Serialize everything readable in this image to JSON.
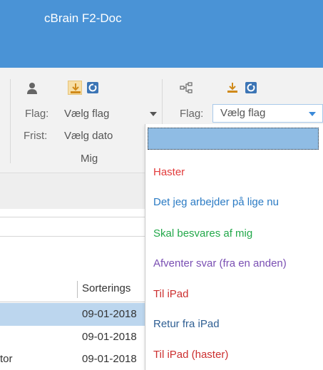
{
  "app": {
    "title": "cBrain F2-Doc"
  },
  "ribbon": {
    "left_group": {
      "flag_label": "Flag:",
      "flag_value": "Vælg flag",
      "deadline_label": "Frist:",
      "deadline_value": "Vælg dato",
      "group_caption": "Mig",
      "icons": [
        "person-icon",
        "download-icon",
        "refresh-icon"
      ]
    },
    "right_group": {
      "flag_label": "Flag:",
      "flag_value": "Vælg flag",
      "icons": [
        "share-nodes-icon",
        "download-icon",
        "refresh-icon"
      ]
    }
  },
  "grid": {
    "column_header": "Sorterings",
    "rows": [
      {
        "name": "",
        "date": "09-01-2018",
        "selected": true
      },
      {
        "name": "",
        "date": "09-01-2018",
        "selected": false
      },
      {
        "name": "tor",
        "date": "09-01-2018",
        "selected": false
      }
    ]
  },
  "flag_dropdown": {
    "input_value": "",
    "options": [
      {
        "label": "Haster",
        "color": "#e23b3b"
      },
      {
        "label": "Det jeg arbejder på lige nu",
        "color": "#2b7bc4"
      },
      {
        "label": "Skal besvares af mig",
        "color": "#22a84a"
      },
      {
        "label": "Afventer svar (fra en anden)",
        "color": "#7a4fb3"
      },
      {
        "label": "Til iPad",
        "color": "#cc2f2f"
      },
      {
        "label": "Retur fra iPad",
        "color": "#2f5f93"
      },
      {
        "label": "Til iPad (haster)",
        "color": "#cc2f2f"
      }
    ]
  },
  "colors": {
    "titlebar": "#4a93d6",
    "ribbon": "#f2f2f2",
    "selection": "#bcd6ee"
  }
}
